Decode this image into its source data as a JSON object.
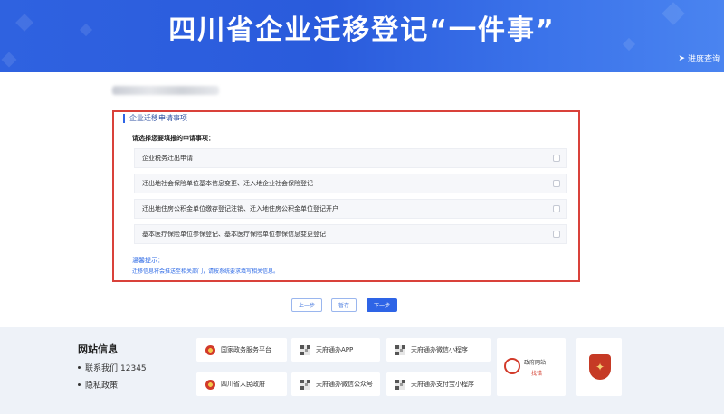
{
  "header": {
    "title": "四川省企业迁移登记“一件事”",
    "progress_link": "进度查询"
  },
  "panel": {
    "title": "企业迁移申请事项",
    "prompt": "请选择您要填报的申请事项：",
    "options": [
      {
        "label": "企业税务迁出申请"
      },
      {
        "label": "迁出地社会保险单位基本信息变更、迁入地企业社会保险登记"
      },
      {
        "label": "迁出地住房公积金单位缴存登记注销、迁入地住房公积金单位登记开户"
      },
      {
        "label": "基本医疗保险单位参保登记、基本医疗保险单位参保信息变更登记"
      }
    ],
    "tip_title": "温馨提示：",
    "tip_text": "迁移信息将会推送至相关部门，请按系统要求填写相关信息。"
  },
  "buttons": {
    "prev": "上一步",
    "save": "暂存",
    "next": "下一步"
  },
  "footer": {
    "site_info_title": "网站信息",
    "contact": "联系我们:12345",
    "privacy": "隐私政策",
    "links": [
      {
        "label": "国家政务服务平台",
        "icon": "national-emblem-icon"
      },
      {
        "label": "天府通办APP",
        "icon": "qr-code-icon"
      },
      {
        "label": "天府通办微信小程序",
        "icon": "qr-code-icon"
      },
      {
        "label": "四川省人民政府",
        "icon": "national-emblem-icon"
      },
      {
        "label": "天府通办微信公众号",
        "icon": "qr-code-icon"
      },
      {
        "label": "天府通办支付宝小程序",
        "icon": "qr-code-icon"
      }
    ],
    "gov_site_top": "政府网站",
    "gov_site_bottom": "找错"
  },
  "colors": {
    "banner_blue": "#2f62e0",
    "highlight_red": "#d9413a",
    "primary_blue": "#2e64e6",
    "footer_bg": "#eef2f8"
  }
}
